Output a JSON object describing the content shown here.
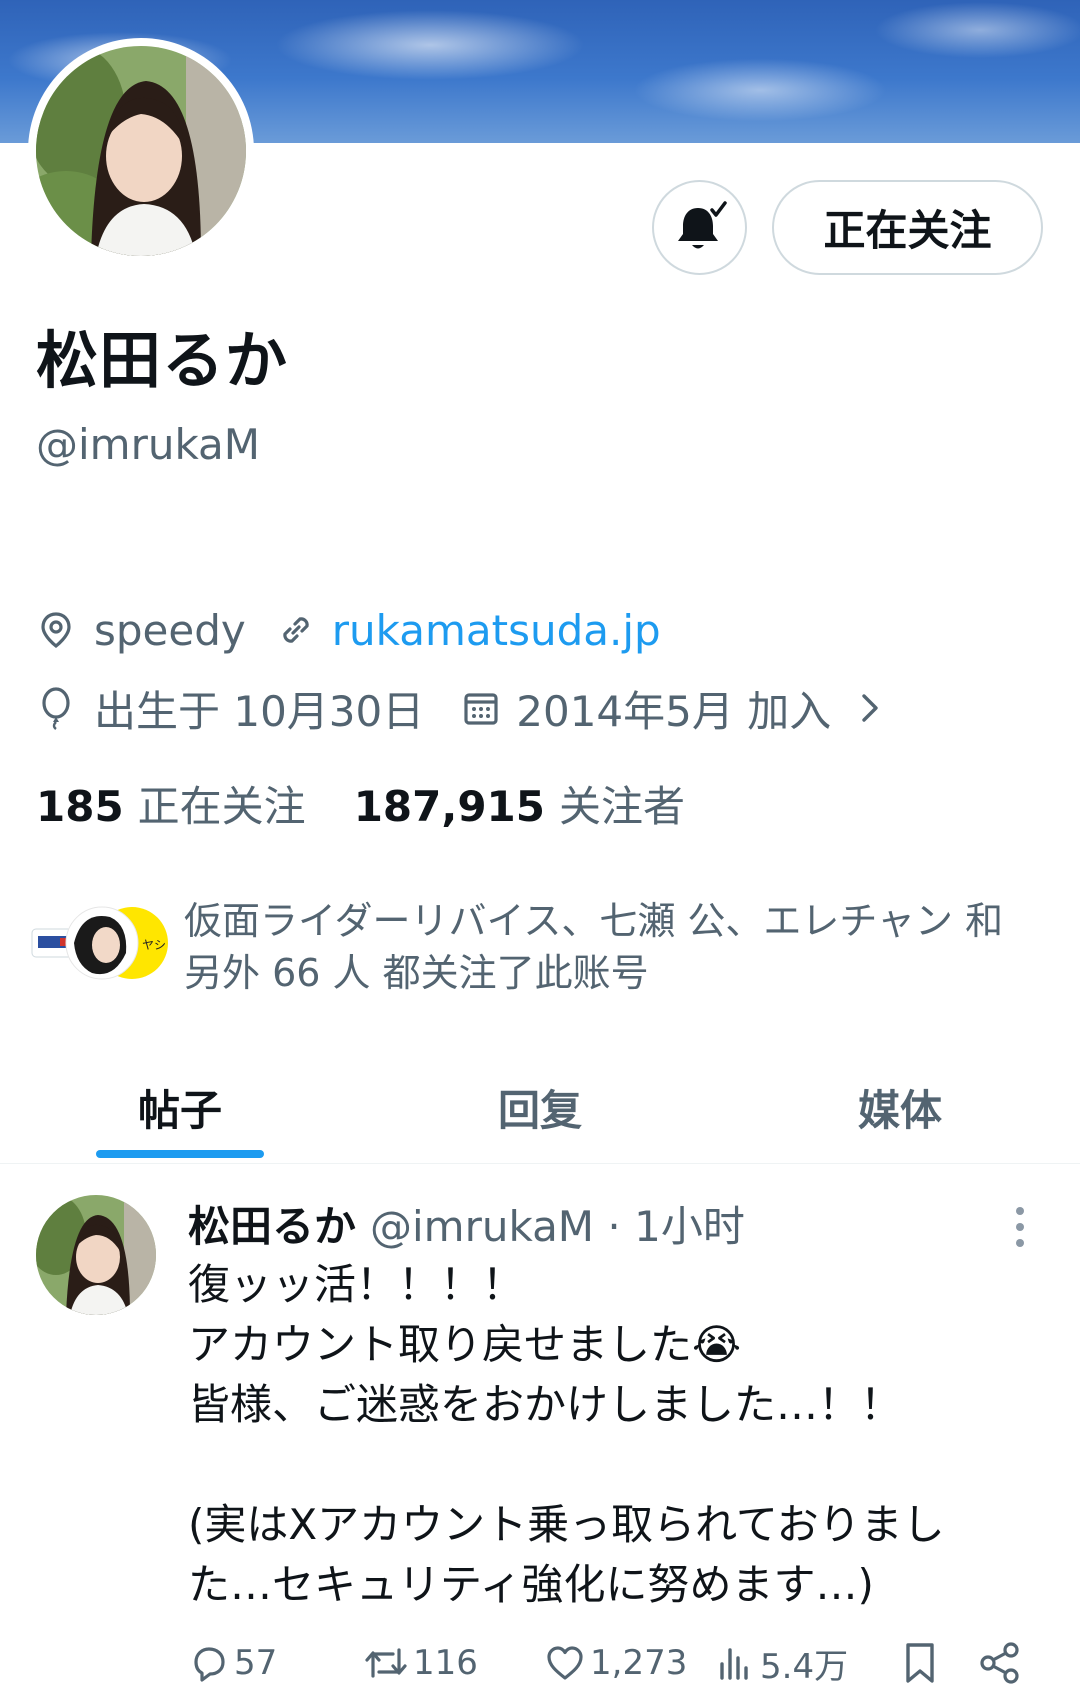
{
  "profile": {
    "name": "松田るか",
    "handle": "@imrukaM",
    "follow_button": "正在关注",
    "location": "speedy",
    "website": "rukamatsuda.jp",
    "birthday": "出生于 10月30日",
    "joined": "2014年5月 加入"
  },
  "stats": {
    "following_count": "185",
    "following_label": "正在关注",
    "followers_count": "187,915",
    "followers_label": "关注者"
  },
  "followers_you_know": {
    "line1": "仮面ライダーリバイス、七瀬 公、エレチャン 和",
    "line2": "另外 66 人 都关注了此账号"
  },
  "tabs": [
    {
      "label": "帖子",
      "active": true
    },
    {
      "label": "回复",
      "active": false
    },
    {
      "label": "媒体",
      "active": false
    }
  ],
  "post": {
    "name": "松田るか",
    "handle": "@imrukaM · 1小时",
    "lines": [
      "復ッッ活！！！！",
      "アカウント取り戻せました😭",
      "皆様、ご迷惑をおかけしました…！！",
      "",
      "(実はXアカウント乗っ取られておりまし",
      "た…セキュリティ強化に努めます…)"
    ],
    "replies": "57",
    "reposts": "116",
    "likes": "1,273",
    "views": "5.4万"
  },
  "colors": {
    "accent": "#1d9bf0",
    "text_primary": "#0f1419",
    "text_secondary": "#536471",
    "border": "#cfd9de"
  },
  "icons": [
    "bell-check-icon",
    "location-pin-icon",
    "link-icon",
    "balloon-icon",
    "calendar-icon",
    "chevron-right-icon",
    "more-vertical-icon",
    "reply-icon",
    "repost-icon",
    "like-icon",
    "views-icon",
    "bookmark-icon",
    "share-icon"
  ]
}
